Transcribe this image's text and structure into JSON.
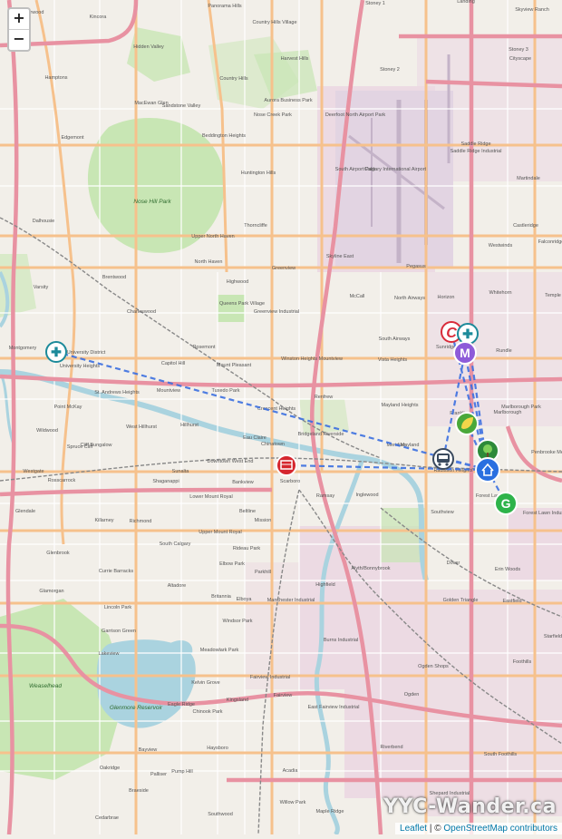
{
  "controls": {
    "zoom_in": "+",
    "zoom_out": "−"
  },
  "watermark": "YYC-Wander.ca",
  "attribution": {
    "leaflet": "Leaflet",
    "separator": " | © ",
    "osm": "OpenStreetMap contributors"
  },
  "colors": {
    "route": "#3b6fe0",
    "park": "#c8e6b4",
    "water": "#aad3df",
    "industrial": "#ead5e0",
    "airport": "#e6d9e6",
    "highway": "#e892a2",
    "primary": "#f6c18c"
  },
  "markers": [
    {
      "id": "home",
      "icon": "house-icon",
      "glyph": "⌂",
      "color": "#2a6fe0"
    },
    {
      "id": "transit",
      "icon": "bus-icon",
      "glyph": "🚌",
      "color": "#3a4a5e"
    },
    {
      "id": "market",
      "icon": "letter-m-icon",
      "glyph": "M",
      "color": "#8e5bd9"
    },
    {
      "id": "grocery",
      "icon": "letter-g-icon",
      "glyph": "G",
      "color": "#2eb34a"
    },
    {
      "id": "park",
      "icon": "tree-icon",
      "glyph": "♣",
      "color": "#2d8a3a"
    },
    {
      "id": "garden",
      "icon": "leaf-icon",
      "glyph": "❦",
      "color": "#4aa83a"
    },
    {
      "id": "restaurant",
      "icon": "canadian-restaurant-icon",
      "glyph": "C",
      "color": "#d92b3a"
    },
    {
      "id": "clinic-ne",
      "icon": "medical-cross-icon",
      "glyph": "✚",
      "color": "#1c8a9a"
    },
    {
      "id": "clinic-nw",
      "icon": "medical-cross-icon",
      "glyph": "✚",
      "color": "#1c8a9a"
    },
    {
      "id": "downtown",
      "icon": "building-icon",
      "glyph": "▤",
      "color": "#d5262e"
    }
  ],
  "labels": [
    "Sherwood",
    "Kincora",
    "Panorama Hills",
    "Country Hills Village",
    "Stoney 1",
    "Landing",
    "Skyview Ranch",
    "Hidden Valley",
    "Harvest Hills",
    "Stoney 3",
    "Cityscape",
    "Hamptons",
    "Country Hills",
    "Aurora Business Park",
    "Nose Creek Park",
    "Stoney 2",
    "MacEwan Glen",
    "Sandstone Valley",
    "Deerfoot North Airport Park",
    "Saddle Ridge",
    "Saddle Ridge Industrial",
    "Edgemont",
    "Beddington Heights",
    "South Airport Park",
    "Calgary International Airport",
    "Martindale",
    "Huntington Hills",
    "Nose Hill Park",
    "Castleridge",
    "Dalhousie",
    "Thorncliffe",
    "Upper North Haven",
    "Westwinds",
    "Falconridge",
    "Pegasus",
    "Skyline East",
    "North Haven",
    "Brentwood",
    "Greenview",
    "Varsity",
    "Highwood",
    "McCall",
    "North Airways",
    "Horizon",
    "Whitehorn",
    "Queens Park Village",
    "Charleswood",
    "Greenview Industrial",
    "Temple",
    "Montgomery",
    "University District",
    "South Airways",
    "Sunridge",
    "Rundle",
    "Rosemont",
    "Vista Heights",
    "University Heights",
    "Capitol Hill",
    "Mount Pleasant",
    "Winston Heights Mountview",
    "St. Andrews Heights",
    "Point McKay",
    "Mountview",
    "Tuxedo Park",
    "Renfrew",
    "Mayland Heights",
    "Franklin",
    "Marlborough",
    "Marlborough Park",
    "West Hillhurst",
    "Hillhurst",
    "Crescent Heights",
    "Bridgeland Riverside",
    "Meridian",
    "Wildwood",
    "Spruce Cliff",
    "Eau Claire",
    "Chinatown",
    "Mayland",
    "Penbrooke Meadows",
    "Downtown West End",
    "Radisson Heights",
    "Westgate",
    "Rosscarrock",
    "Sunalta",
    "Beltline",
    "Ramsay",
    "Inglewood",
    "Forest Lawn",
    "Forest Lawn Industrial",
    "Glendale",
    "Killarney",
    "Richmond",
    "Lower Mount Royal",
    "Upper Mount Royal",
    "Mission",
    "Southview",
    "Glenbrook",
    "South Calgary",
    "Rideau Park",
    "Dover",
    "Erin Woods",
    "Currie Barracks",
    "Altadore",
    "Elbow Park",
    "Parkhill",
    "Highfield",
    "Alyth/Bonnybrook",
    "Glamorgan",
    "Lincoln Park",
    "Britannia",
    "Elboya",
    "Manchester Industrial",
    "Golden Triangle",
    "Eastfield",
    "Eagle Ridge",
    "Garrison Green",
    "Windsor Park",
    "Lakeview",
    "Meadowlark Park",
    "Burns Industrial",
    "Starfield",
    "Weaselhead",
    "Kelvin Grove",
    "Fairview Industrial",
    "Ogden Shops",
    "Foothills",
    "Chinook Park",
    "Kingsland",
    "Fairview",
    "East Fairview Industrial",
    "Ogden",
    "Glenmore Reservoir",
    "Riverbend",
    "Bayview",
    "South Foothills",
    "Oakridge",
    "Haysboro",
    "Pump Hill",
    "Acadia",
    "Palliser",
    "Braeside",
    "Southwood",
    "Willow Park",
    "Shepard Industrial",
    "Cedarbrae",
    "Maple Ridge",
    "Cliff Bungalow",
    "Shaganappi",
    "Scarboro",
    "Bankview"
  ]
}
